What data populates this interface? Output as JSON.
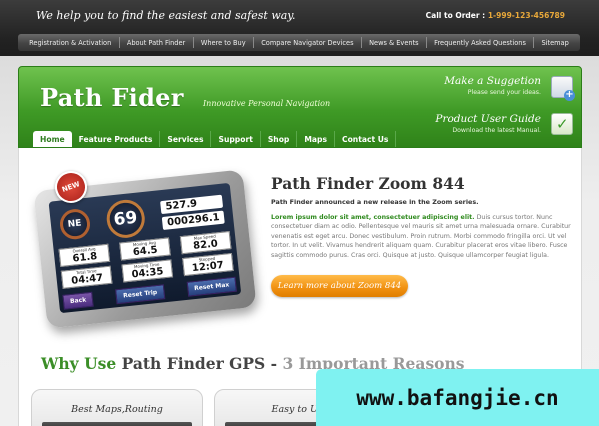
{
  "top": {
    "tagline": "We help you to find the easiest and safest way.",
    "order_label": "Call to Order :",
    "order_number": "1-999-123-456789"
  },
  "topnav": [
    {
      "label": "Registration & Activation"
    },
    {
      "label": "About Path Finder"
    },
    {
      "label": "Where to Buy"
    },
    {
      "label": "Compare Navigator Devices"
    },
    {
      "label": "News & Events"
    },
    {
      "label": "Frequently Asked Questions"
    },
    {
      "label": "Sitemap"
    }
  ],
  "header": {
    "logo": "Path Fider",
    "slogan": "Innovative Personal Navigation",
    "promo1_title": "Make a Suggetion",
    "promo1_sub": "Please send your ideas.",
    "promo2_title": "Product User Guide",
    "promo2_sub": "Download the latest Manual."
  },
  "mainnav": [
    {
      "label": "Home",
      "active": true
    },
    {
      "label": "Feature Products"
    },
    {
      "label": "Services"
    },
    {
      "label": "Support"
    },
    {
      "label": "Shop"
    },
    {
      "label": "Maps"
    },
    {
      "label": "Contact Us"
    }
  ],
  "device": {
    "badge": "NEW",
    "compass": "NE",
    "speed": "69",
    "speed_unit": "mph",
    "dist1": "527.9",
    "dist2": "000296.1",
    "cells": [
      {
        "label": "Overall Avg",
        "value": "61.8"
      },
      {
        "label": "Moving Avg",
        "value": "64.5"
      },
      {
        "label": "Max Speed",
        "value": "82.0"
      },
      {
        "label": "Total Time",
        "value": "04:47"
      },
      {
        "label": "Moving Time",
        "value": "04:35"
      },
      {
        "label": "Stopped",
        "value": "12:07"
      }
    ],
    "btn_back": "Back",
    "btn_reset_trip": "Reset Trip",
    "btn_reset_max": "Reset Max"
  },
  "product": {
    "title": "Path Finder Zoom 844",
    "subtitle": "Path Finder announced a new release in the Zoom series.",
    "lead": "Lorem ipsum dolor sit amet, consectetuer adipiscing elit.",
    "body": "Duis cursus tortor. Nunc consectetuer diam ac odio. Pellentesque vel mauris sit amet urna malesuada ornare. Curabitur venenatis est eget arcu. Donec vestibulum. Proin rutrum. Morbi commodo fringilla orci. Ut vel tortor. In ut velit. Vivamus hendrerit aliquam quam. Curabitur placerat eros vitae libero. Fusce sagittis commodo purus. Cras orci. Quisque at justo. Quisque ullamcorper feugiat ligula.",
    "learn_more": "Learn more about Zoom 844"
  },
  "why": {
    "part1": "Why Use",
    "part2": "Path Finder GPS -",
    "part3": "3 Important Reasons"
  },
  "cards": [
    {
      "title": "Best Maps,Routing"
    },
    {
      "title": "Easy to Use"
    }
  ],
  "watermark": "www.bafangjie.cn"
}
